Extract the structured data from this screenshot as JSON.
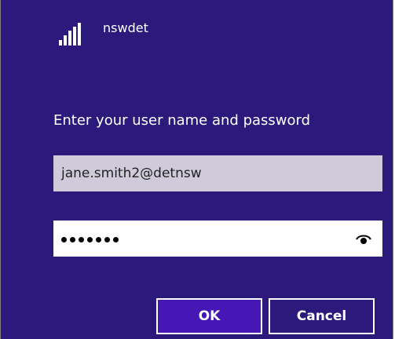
{
  "network": {
    "name": "nswdet",
    "icon": "wifi-signal-icon"
  },
  "prompt": "Enter your user name and password",
  "username": {
    "value": "jane.smith2@detnsw"
  },
  "password": {
    "masked_length": 7,
    "reveal_icon": "eye-icon"
  },
  "buttons": {
    "ok_label": "OK",
    "cancel_label": "Cancel"
  },
  "colors": {
    "background": "#2b1a7b",
    "primary_button": "#4617b4",
    "username_field": "#cfcbda"
  }
}
